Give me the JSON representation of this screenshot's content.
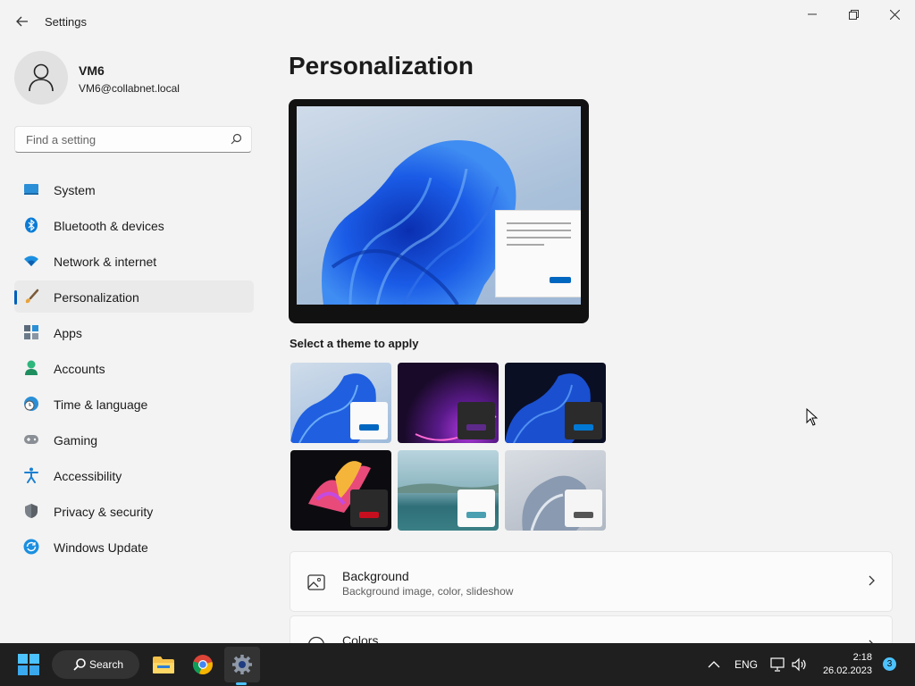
{
  "app": {
    "title": "Settings"
  },
  "window_controls": {
    "minimize_icon": "minimize-icon",
    "maximize_icon": "restore-icon",
    "close_icon": "close-icon"
  },
  "profile": {
    "name": "VM6",
    "email": "VM6@collabnet.local"
  },
  "search": {
    "placeholder": "Find a setting"
  },
  "sidebar": {
    "items": [
      {
        "label": "System",
        "icon": "system-icon"
      },
      {
        "label": "Bluetooth & devices",
        "icon": "bluetooth-icon"
      },
      {
        "label": "Network & internet",
        "icon": "wifi-icon"
      },
      {
        "label": "Personalization",
        "icon": "brush-icon",
        "active": true
      },
      {
        "label": "Apps",
        "icon": "apps-icon"
      },
      {
        "label": "Accounts",
        "icon": "accounts-icon"
      },
      {
        "label": "Time & language",
        "icon": "globe-clock-icon"
      },
      {
        "label": "Gaming",
        "icon": "gamepad-icon"
      },
      {
        "label": "Accessibility",
        "icon": "accessibility-icon"
      },
      {
        "label": "Privacy & security",
        "icon": "shield-icon"
      },
      {
        "label": "Windows Update",
        "icon": "update-icon"
      }
    ]
  },
  "main": {
    "title": "Personalization",
    "themes_label": "Select a theme to apply",
    "themes": [
      {
        "name": "theme-windows-light",
        "accent": "#0067c0"
      },
      {
        "name": "theme-glow",
        "accent": "#5d2a8a"
      },
      {
        "name": "theme-windows-dark",
        "accent": "#0078d4"
      },
      {
        "name": "theme-captured-motion",
        "accent": "#c50f1f"
      },
      {
        "name": "theme-sunrise",
        "accent": "#4a9fb0"
      },
      {
        "name": "theme-flow",
        "accent": "#555555"
      }
    ],
    "cards": [
      {
        "title": "Background",
        "subtitle": "Background image, color, slideshow",
        "icon": "image-icon"
      },
      {
        "title": "Colors",
        "subtitle": "",
        "icon": "palette-icon"
      }
    ]
  },
  "taskbar": {
    "search_label": "Search",
    "language": "ENG",
    "time": "2:18",
    "date": "26.02.2023",
    "notification_count": "3"
  },
  "colors": {
    "accent": "#005fb8",
    "taskbar": "#1f1f1f",
    "background": "#f3f3f3"
  }
}
